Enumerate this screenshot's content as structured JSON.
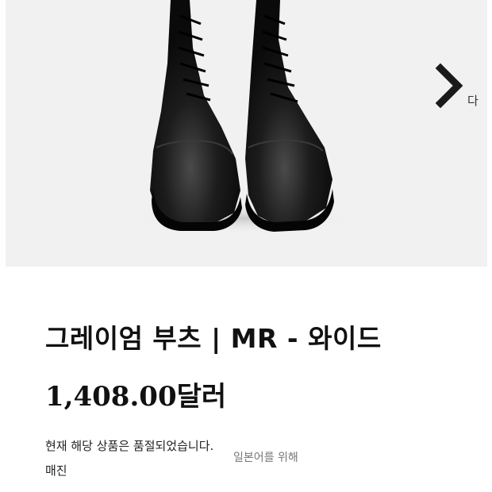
{
  "product": {
    "image_alt": "그레이엄 부츠",
    "next_label": "다",
    "title": "그레이엄 부츠 | MR - 와이드",
    "price": "1,408.00달러",
    "status": "현재 해당 상품은 품절되었습니다.",
    "translation_overlay": "일본어를 위해",
    "soldout_label": "매진"
  },
  "icons": {
    "next": "chevron-right-icon"
  },
  "colors": {
    "image_background": "#f1f1f1",
    "text": "#111111",
    "muted_text": "#777777"
  }
}
